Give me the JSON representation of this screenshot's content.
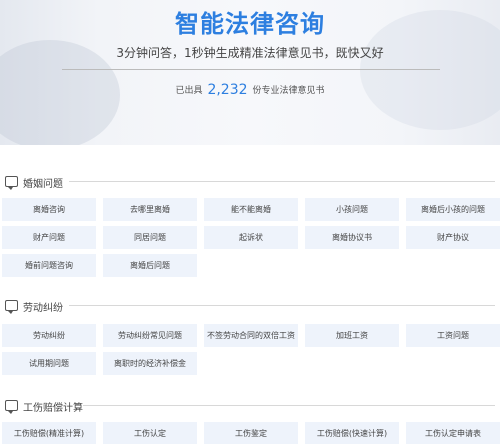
{
  "hero": {
    "title": "智能法律咨询",
    "subtitle": "3分钟问答，1秒钟生成精准法律意见书，既快又好",
    "count_prefix": "已出具",
    "count_value": "2,232",
    "count_suffix": "份专业法律意见书"
  },
  "sections": [
    {
      "title": "婚姻问题",
      "icon": "chat-bubble-icon",
      "items": [
        "离婚咨询",
        "去哪里离婚",
        "能不能离婚",
        "小孩问题",
        "离婚后小孩的问题",
        "财产问题",
        "同居问题",
        "起诉状",
        "离婚协议书",
        "财产协议",
        "婚前问题咨询",
        "离婚后问题"
      ]
    },
    {
      "title": "劳动纠纷",
      "icon": "chat-bubble-icon",
      "items": [
        "劳动纠纷",
        "劳动纠纷常见问题",
        "不签劳动合同的双倍工资",
        "加班工资",
        "工资问题",
        "试用期问题",
        "离职时的经济补偿金"
      ]
    },
    {
      "title": "工伤赔偿计算",
      "icon": "chat-bubble-icon",
      "items": [
        "工伤赔偿(精准计算)",
        "工伤认定",
        "工伤鉴定",
        "工伤赔偿(快速计算)",
        "工伤认定申请表"
      ]
    }
  ],
  "colors": {
    "accent": "#2d7fe0",
    "cell_bg": "#eef3fb"
  }
}
